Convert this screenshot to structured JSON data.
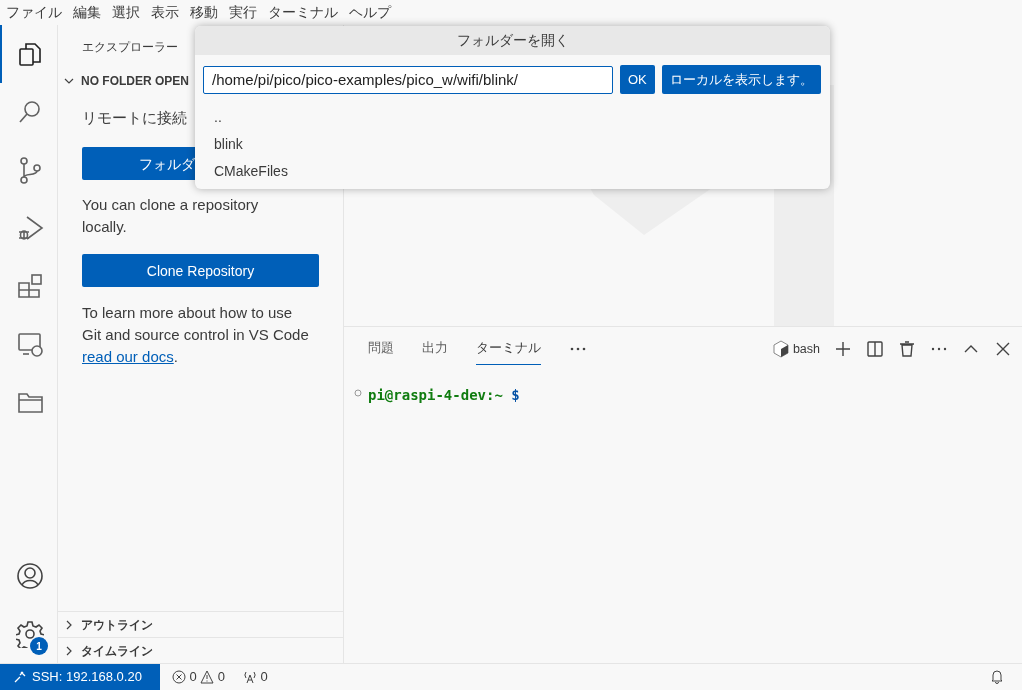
{
  "menu": [
    "ファイル",
    "編集",
    "選択",
    "表示",
    "移動",
    "実行",
    "ターミナル",
    "ヘルプ"
  ],
  "activity_bar": [
    {
      "kind": "files",
      "selected": true
    },
    {
      "kind": "search",
      "selected": false
    },
    {
      "kind": "scm",
      "selected": false
    },
    {
      "kind": "debug",
      "selected": false
    },
    {
      "kind": "extensions",
      "selected": false
    },
    {
      "kind": "remote",
      "selected": false
    },
    {
      "kind": "folder",
      "selected": false
    }
  ],
  "activity_bottom": [
    {
      "kind": "account"
    },
    {
      "kind": "settings",
      "badge": "1"
    }
  ],
  "sidebar": {
    "title": "エクスプローラー",
    "section": {
      "label": "NO FOLDER OPEN",
      "expanded": true
    },
    "remote_text": "リモートに接続",
    "open_button": "フォルダ",
    "clone_text": "You can clone a repository locally.",
    "clone_button": "Clone Repository",
    "learn_text": "To learn more about how to use Git and source control in VS Code",
    "learn_link": "read our docs",
    "learn_tail": ".",
    "collapsed": [
      {
        "label": "アウトライン",
        "expanded": false
      },
      {
        "label": "タイムライン",
        "expanded": false
      }
    ]
  },
  "dialog": {
    "title": "フォルダーを開く",
    "value": "/home/pi/pico/pico-examples/pico_w/wifi/blink/",
    "buttons": [
      "OK",
      "ローカルを表示します。"
    ],
    "items": [
      "..",
      "blink",
      "CMakeFiles"
    ]
  },
  "panel": {
    "tabs": [
      {
        "label": "問題",
        "selected": false
      },
      {
        "label": "出力",
        "selected": false
      },
      {
        "label": "ターミナル",
        "selected": true
      }
    ],
    "shell": "bash",
    "prompt_user": "pi@raspi-4-dev",
    "prompt_path": ":~",
    "prompt_symbol": "$"
  },
  "status_bar": {
    "remote": "SSH: 192.168.0.20",
    "errors": "0",
    "warnings": "0",
    "ports": "0"
  }
}
